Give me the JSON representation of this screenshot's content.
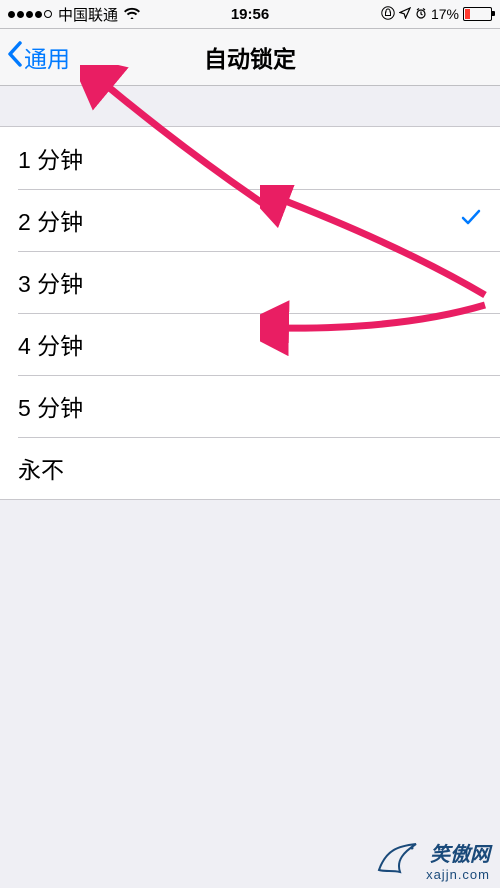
{
  "status_bar": {
    "carrier": "中国联通",
    "time": "19:56",
    "battery_percent": "17%"
  },
  "nav": {
    "back_label": "通用",
    "title": "自动锁定"
  },
  "options": {
    "items": [
      {
        "label": "1 分钟",
        "selected": false
      },
      {
        "label": "2 分钟",
        "selected": true
      },
      {
        "label": "3 分钟",
        "selected": false
      },
      {
        "label": "4 分钟",
        "selected": false
      },
      {
        "label": "5 分钟",
        "selected": false
      },
      {
        "label": "永不",
        "selected": false
      }
    ]
  },
  "watermark": {
    "name": "笑傲网",
    "url": "xajjn.com"
  }
}
